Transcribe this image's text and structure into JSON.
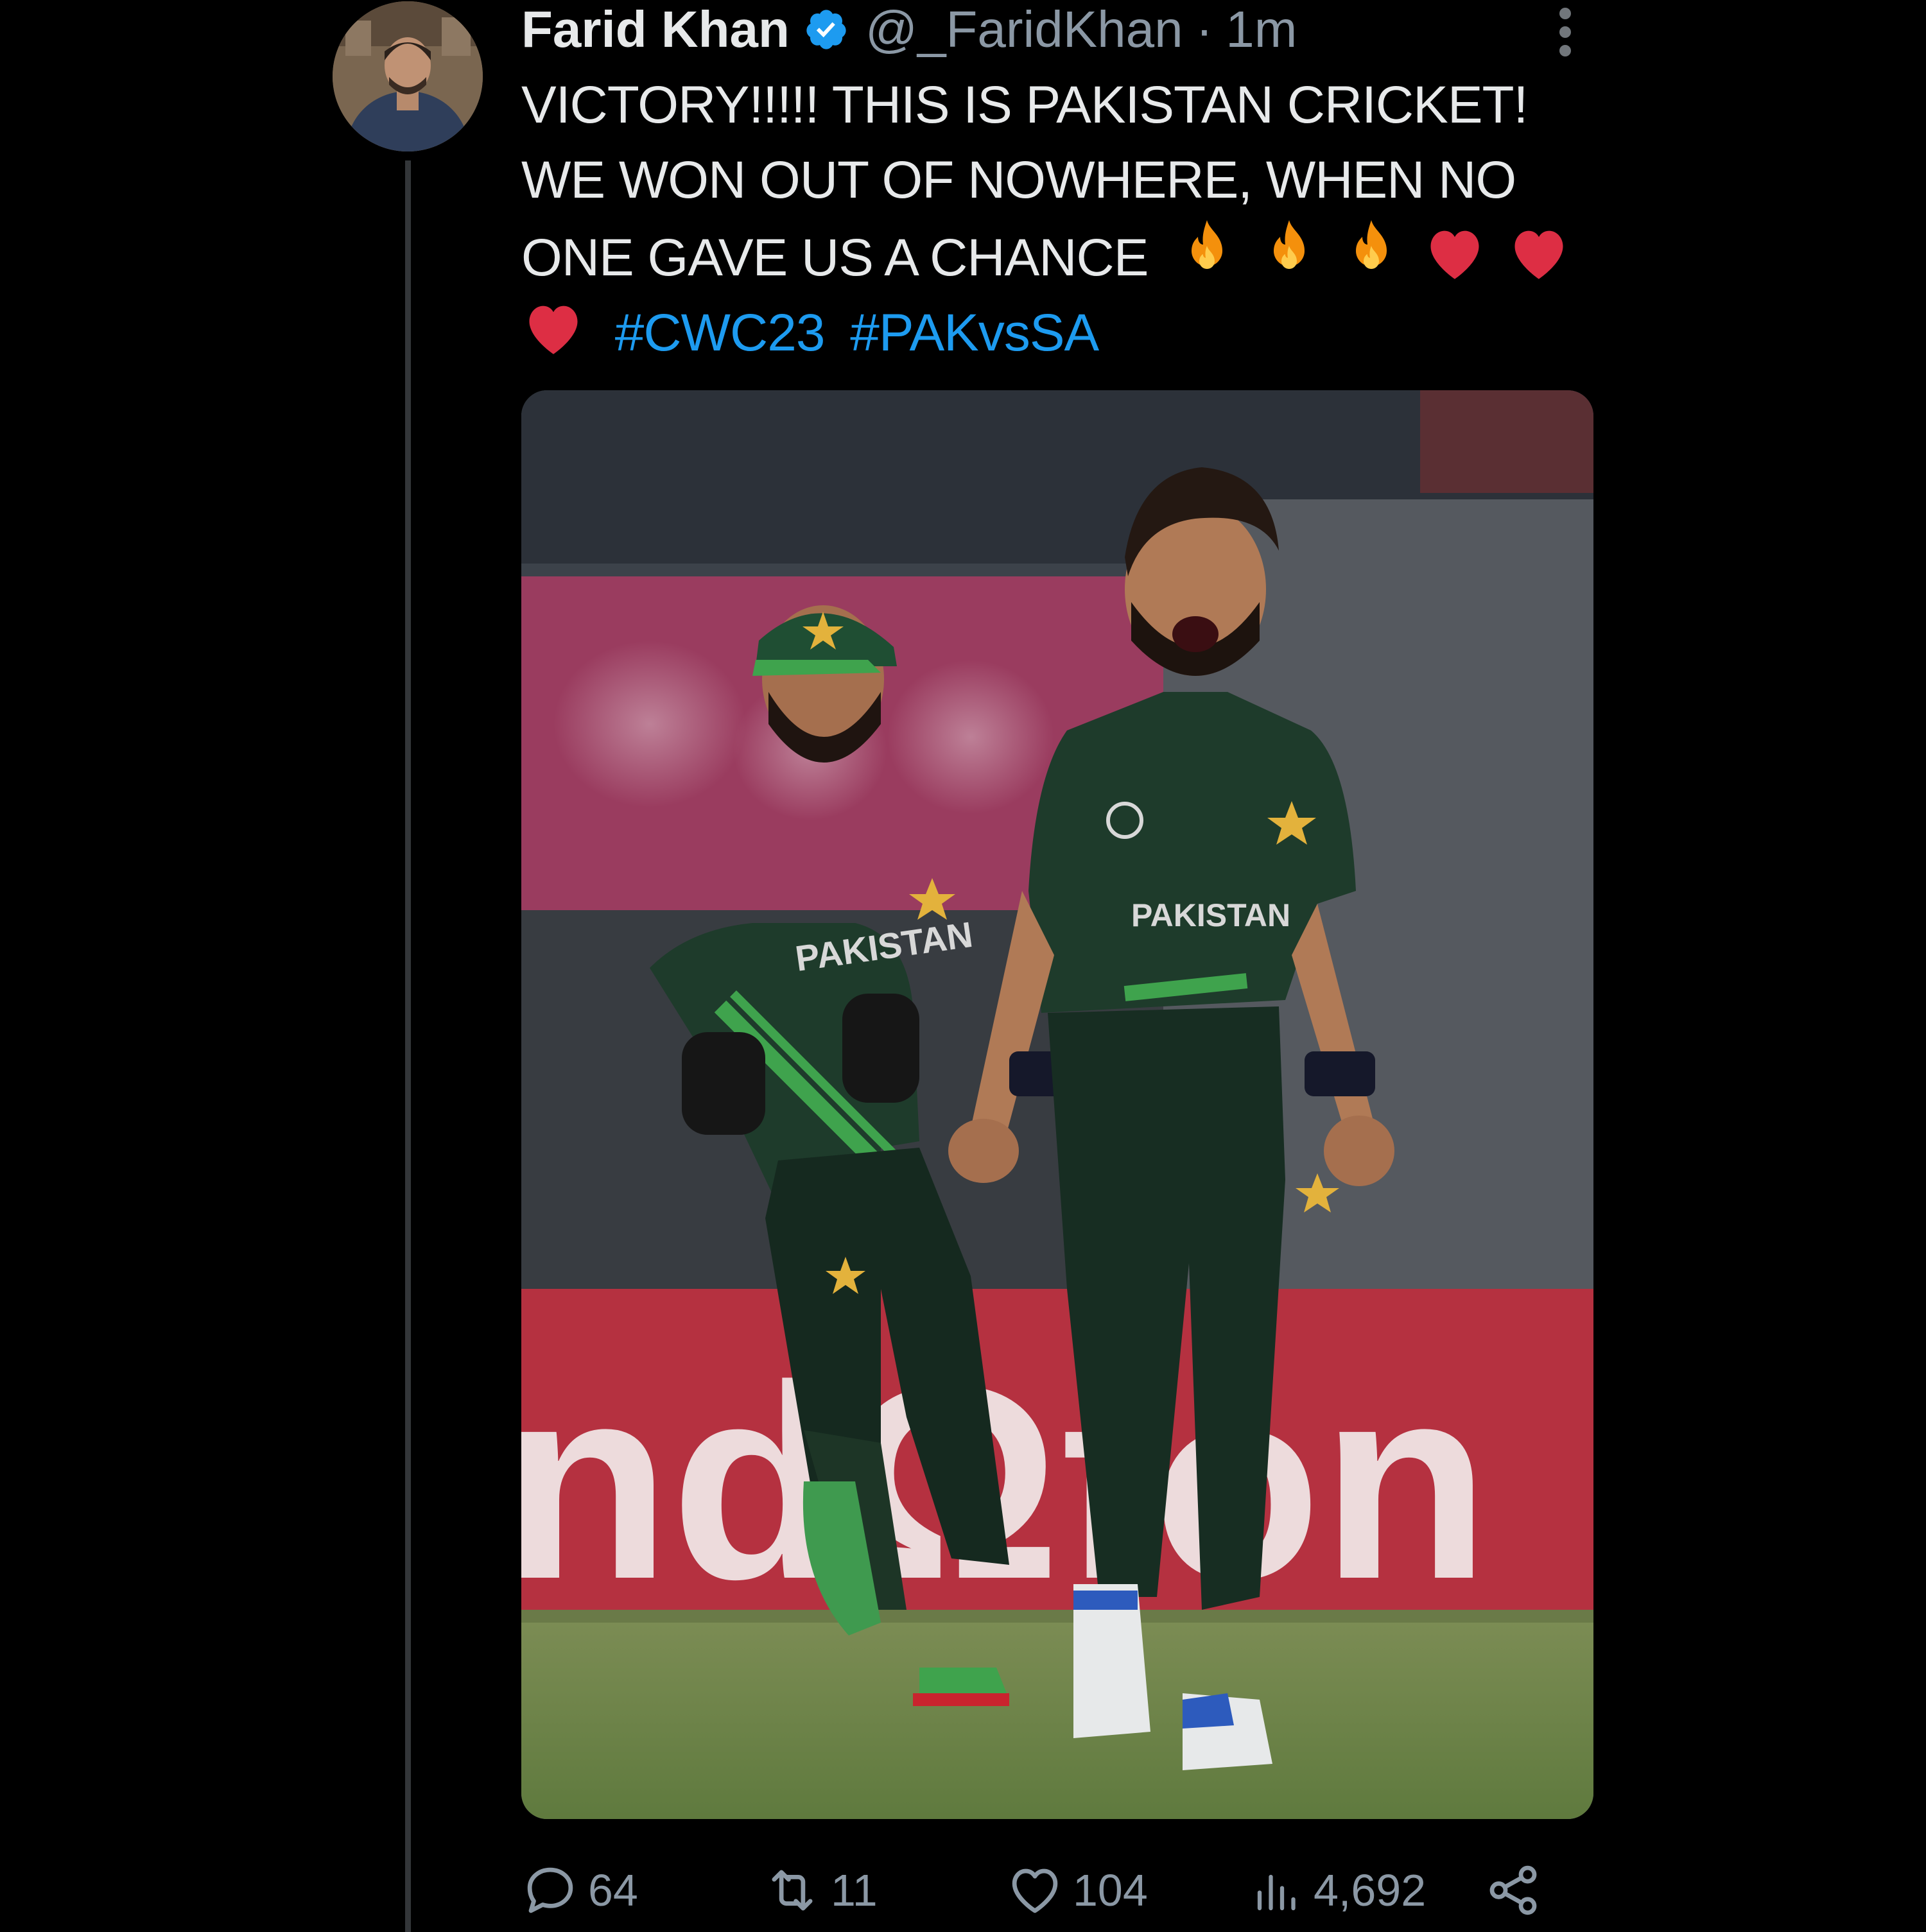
{
  "tweet": {
    "display_name": "Farid Khan",
    "handle": "@_FaridKhan",
    "separator": "·",
    "time": "1m",
    "text_lines": [
      "VICTORY!!!!! THIS IS PAKISTAN CRICKET!",
      "WE WON OUT OF NOWHERE, WHEN NO",
      "ONE GAVE US A CHANCE"
    ],
    "hashtags": [
      "#CWC23",
      "#PAKvsSA"
    ],
    "emoji": [
      "fire",
      "fire",
      "fire",
      "red-heart",
      "red-heart",
      "red-heart"
    ],
    "media": {
      "jersey_text_left": "PAKISTAN",
      "jersey_text_right": "PAKISTAN"
    },
    "actions": {
      "replies": "64",
      "reposts": "11",
      "likes": "104",
      "views": "4,692"
    }
  },
  "icons": {
    "verified": "verified-badge-icon",
    "more": "more-options-icon",
    "reply": "reply-icon",
    "repost": "repost-icon",
    "like": "heart-icon",
    "views": "views-icon",
    "share": "share-icon"
  },
  "colors": {
    "background": "#000000",
    "text": "#e7e9ea",
    "muted": "#8b98a5",
    "link": "#1d9bf0",
    "verified": "#1d9bf0",
    "jersey_green": "#1f3b2c"
  }
}
